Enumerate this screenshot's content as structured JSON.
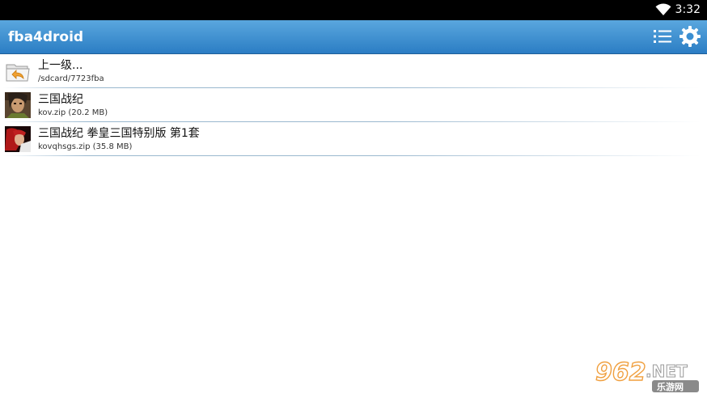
{
  "status_bar": {
    "time": "3:32",
    "wifi_icon": "wifi-icon"
  },
  "action_bar": {
    "title": "fba4droid",
    "list_icon": "list-icon",
    "settings_icon": "gear-icon"
  },
  "files": [
    {
      "name": "上一级...",
      "detail": "/sdcard/7723fba",
      "icon": "folder-up-icon"
    },
    {
      "name": "三国战纪",
      "detail": "kov.zip  (20.2 MB)",
      "icon": "game-thumbnail"
    },
    {
      "name": "三国战纪 拳皇三国特别版 第1套",
      "detail": "kovqhsgs.zip  (35.8 MB)",
      "icon": "game-thumbnail"
    }
  ],
  "watermark": {
    "number": "962",
    "suffix": ".NET",
    "caption": "乐游网"
  }
}
